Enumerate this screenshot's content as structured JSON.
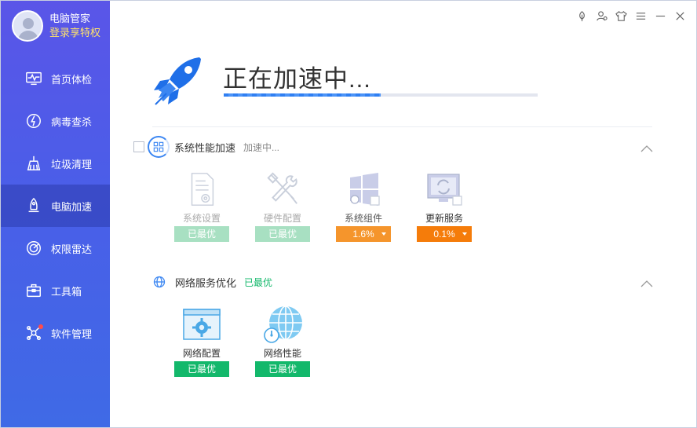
{
  "profile": {
    "app_name": "电脑管家",
    "login_text": "登录享特权"
  },
  "nav": [
    {
      "label": "首页体检",
      "icon": "monitor-pulse-icon"
    },
    {
      "label": "病毒查杀",
      "icon": "lightning-shield-icon"
    },
    {
      "label": "垃圾清理",
      "icon": "broom-icon"
    },
    {
      "label": "电脑加速",
      "icon": "rocket-bell-icon",
      "active": true
    },
    {
      "label": "权限雷达",
      "icon": "radar-icon"
    },
    {
      "label": "工具箱",
      "icon": "toolbox-icon"
    },
    {
      "label": "软件管理",
      "icon": "software-icon",
      "has_dot": true
    }
  ],
  "titlebar": {
    "icons": [
      "leaf-icon",
      "user-skin-icon",
      "tshirt-icon",
      "menu-icon",
      "minimize-icon",
      "close-icon"
    ]
  },
  "header": {
    "title": "正在加速中...",
    "progress_percent": 50
  },
  "section_system": {
    "title": "系统性能加速",
    "status": "加速中...",
    "items": [
      {
        "label": "系统设置",
        "badge": "已最优",
        "state": "done-light",
        "icon": "document-gear-icon"
      },
      {
        "label": "硬件配置",
        "badge": "已最优",
        "state": "done-light",
        "icon": "tools-icon"
      },
      {
        "label": "系统组件",
        "badge": "1.6%",
        "state": "orange-light",
        "icon": "windows-icon"
      },
      {
        "label": "更新服务",
        "badge": "0.1%",
        "state": "orange",
        "icon": "monitor-refresh-icon"
      }
    ]
  },
  "section_network": {
    "title": "网络服务优化",
    "status": "已最优",
    "items": [
      {
        "label": "网络配置",
        "badge": "已最优",
        "state": "done",
        "icon": "browser-gear-icon"
      },
      {
        "label": "网络性能",
        "badge": "已最优",
        "state": "done",
        "icon": "globe-gauge-icon"
      }
    ]
  },
  "colors": {
    "sidebar_top": "#5a55e8",
    "sidebar_bottom": "#3f6ae6",
    "accent_blue": "#2f7ff2",
    "green": "#13b86b",
    "orange": "#f57c0a",
    "gold": "#ffe36a"
  }
}
